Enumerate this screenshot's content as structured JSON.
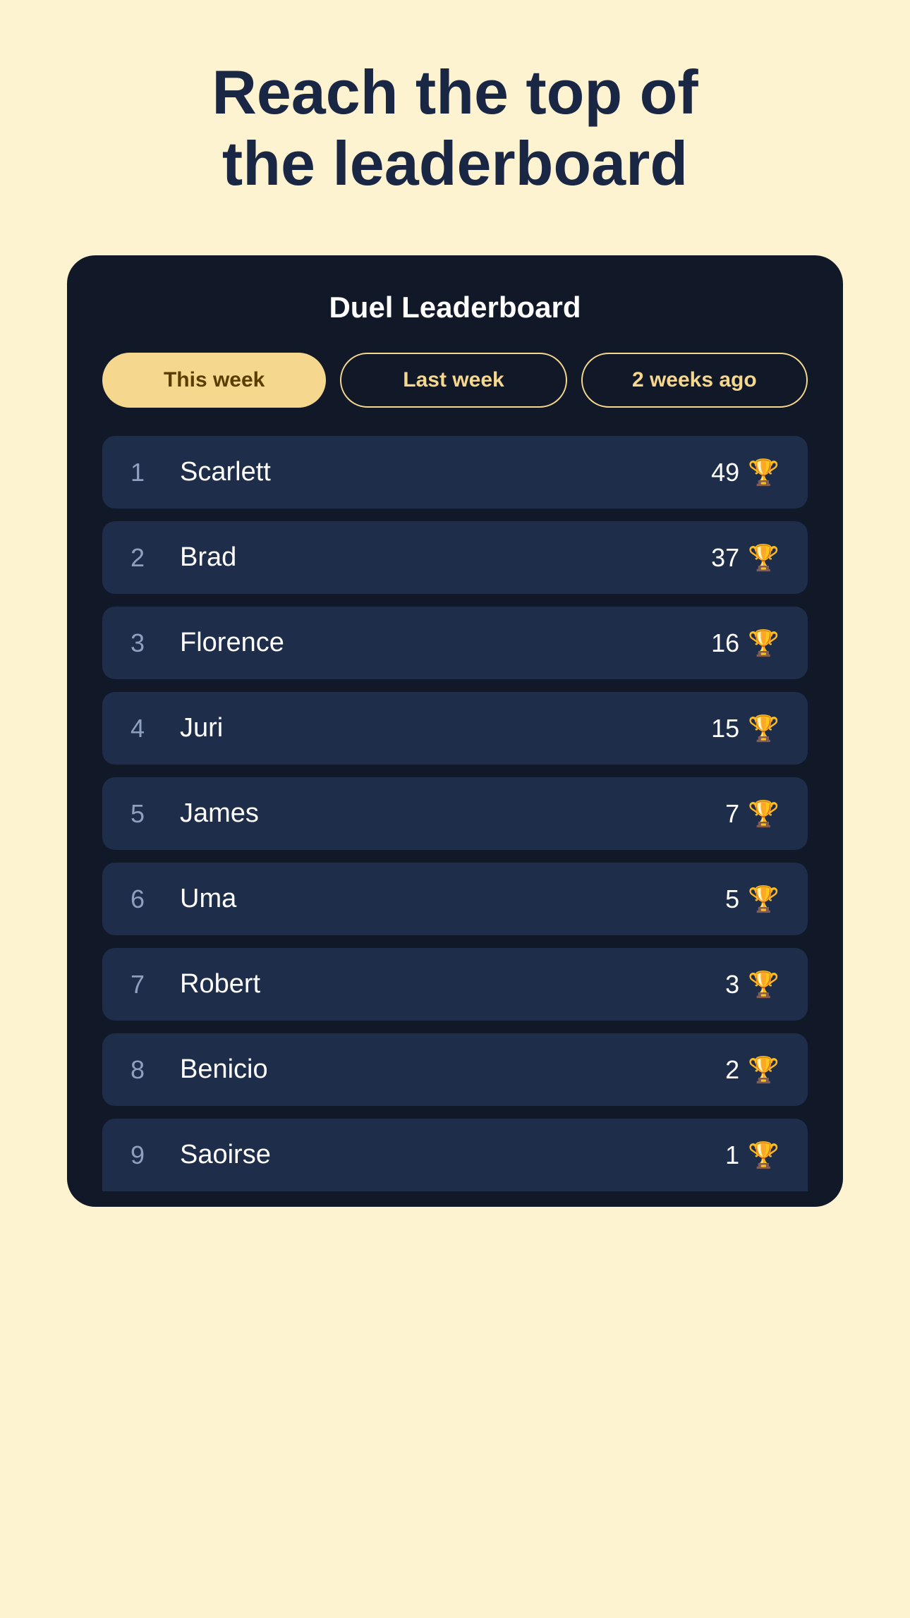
{
  "hero": {
    "title": "Reach the top of the leaderboard"
  },
  "leaderboard": {
    "title": "Duel Leaderboard",
    "tabs": [
      {
        "label": "This week",
        "active": true
      },
      {
        "label": "Last week",
        "active": false
      },
      {
        "label": "2 weeks ago",
        "active": false
      }
    ],
    "entries": [
      {
        "rank": 1,
        "name": "Scarlett",
        "score": 49
      },
      {
        "rank": 2,
        "name": "Brad",
        "score": 37
      },
      {
        "rank": 3,
        "name": "Florence",
        "score": 16
      },
      {
        "rank": 4,
        "name": "Juri",
        "score": 15
      },
      {
        "rank": 5,
        "name": "James",
        "score": 7
      },
      {
        "rank": 6,
        "name": "Uma",
        "score": 5
      },
      {
        "rank": 7,
        "name": "Robert",
        "score": 3
      },
      {
        "rank": 8,
        "name": "Benicio",
        "score": 2
      },
      {
        "rank": 9,
        "name": "Saoirse",
        "score": 1
      }
    ],
    "trophy_symbol": "🏆"
  }
}
